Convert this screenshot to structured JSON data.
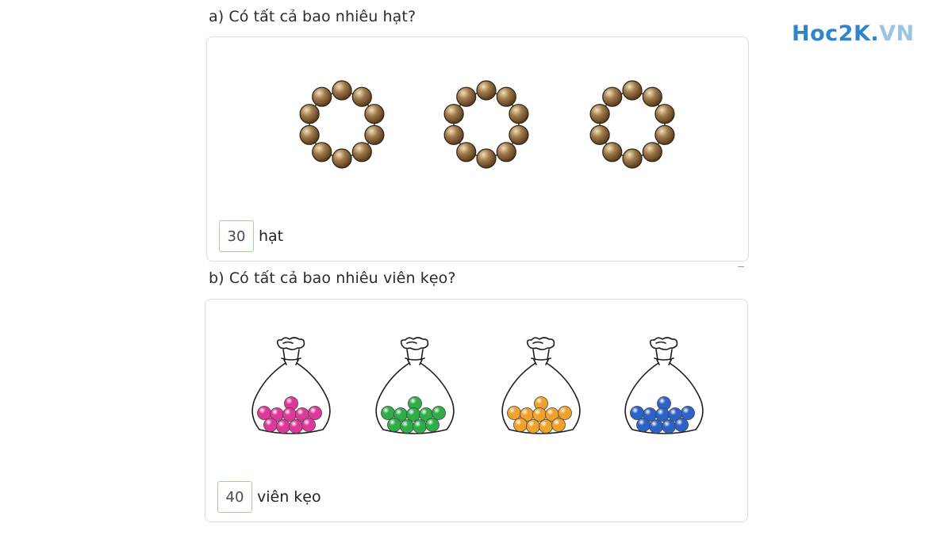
{
  "logo": {
    "main": "Hoc2K.",
    "tail": "VN"
  },
  "section_a": {
    "question": "a) Có tất cả bao nhiêu hạt?",
    "answer_value": "30",
    "answer_unit": "hạt",
    "bead_color": "#a07a4c",
    "ring_count": 3,
    "beads_per_ring": 10
  },
  "section_b": {
    "question": "b) Có tất cả bao nhiêu viên kẹo?",
    "answer_value": "40",
    "answer_unit": "viên kẹo",
    "bags": [
      {
        "candy_color": "#e0389a",
        "candies": 10
      },
      {
        "candy_color": "#2fae48",
        "candies": 10
      },
      {
        "candy_color": "#f0a22a",
        "candies": 10
      },
      {
        "candy_color": "#2c63c9",
        "candies": 10
      }
    ]
  }
}
